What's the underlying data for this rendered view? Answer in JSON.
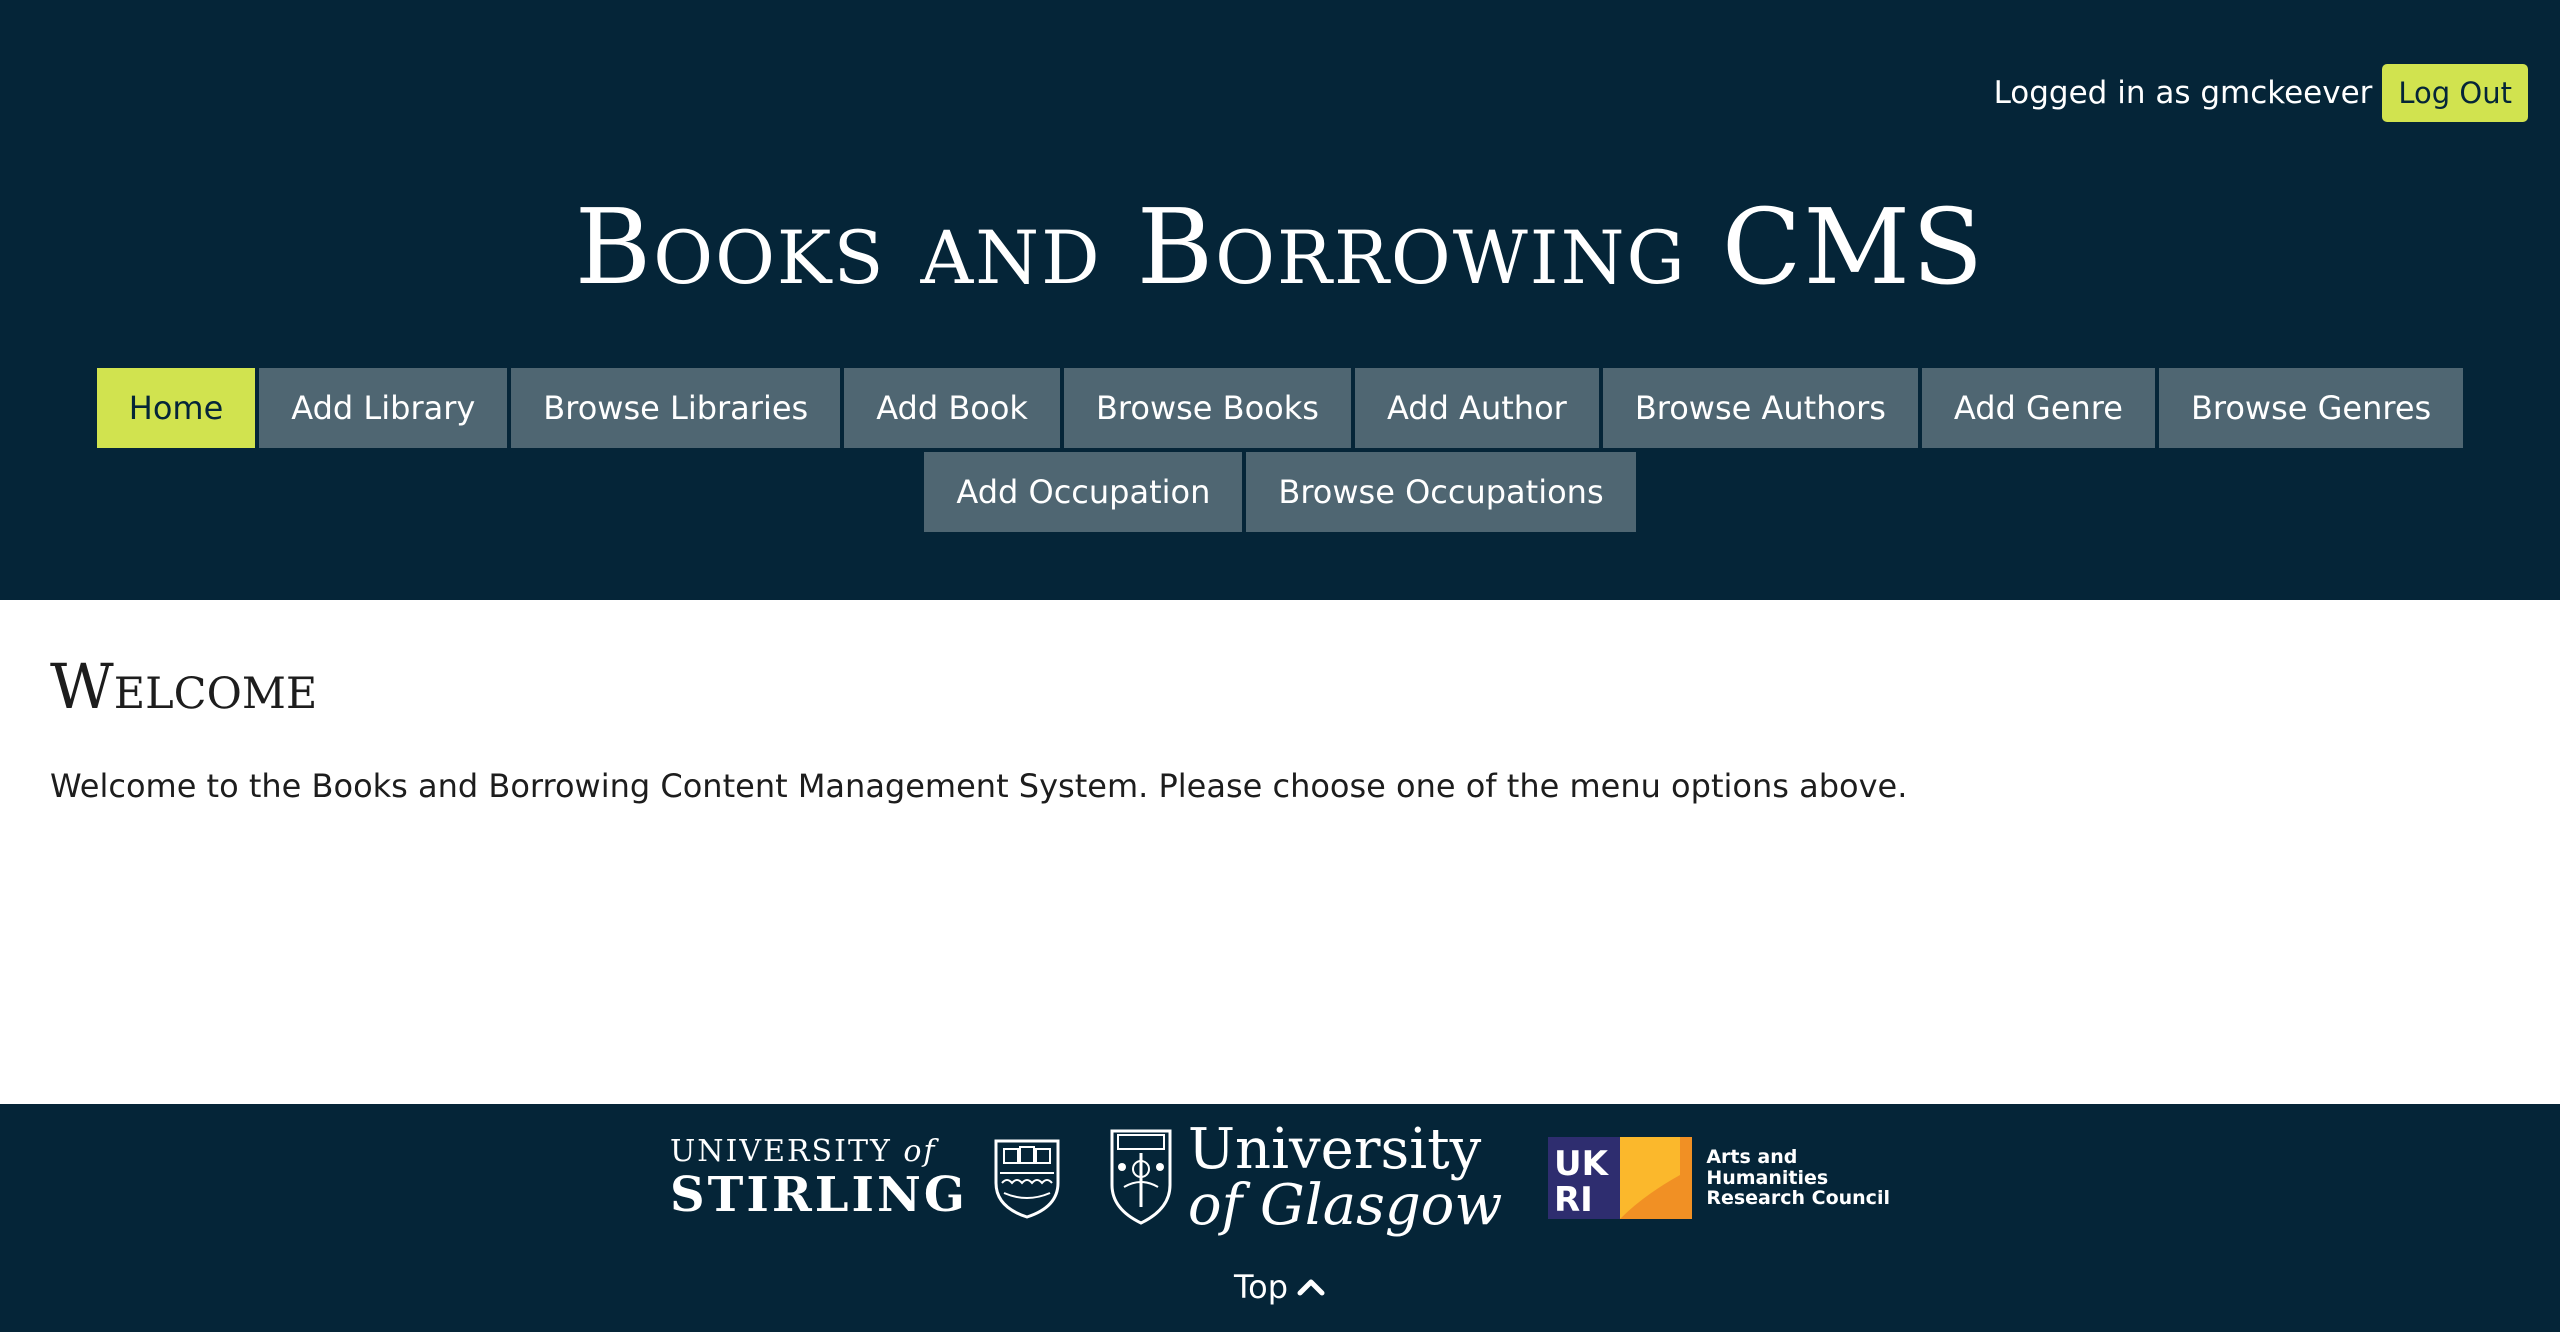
{
  "header": {
    "login_text": "Logged in as gmckeever",
    "logout_label": "Log Out",
    "site_title": "Books and Borrowing CMS"
  },
  "nav": {
    "row1": [
      "Home",
      "Add Library",
      "Browse Libraries",
      "Add Book",
      "Browse Books",
      "Add Author",
      "Browse Authors",
      "Add Genre",
      "Browse Genres"
    ],
    "row2": [
      "Add Occupation",
      "Browse Occupations"
    ],
    "active": "Home"
  },
  "main": {
    "title": "Welcome",
    "text": "Welcome to the Books and Borrowing Content Management System. Please choose one of the menu options above."
  },
  "footer": {
    "stirling_top": "UNIVERSITY",
    "stirling_of": "of",
    "stirling_main": "STIRLING",
    "glasgow_a": "University",
    "glasgow_b": "of Glasgow",
    "ukri_line1": "Arts and",
    "ukri_line2": "Humanities",
    "ukri_line3": "Research Council",
    "top_label": "Top"
  },
  "colors": {
    "header_bg": "#052538",
    "accent": "#d1e34f",
    "nav_bg": "#4f6672"
  },
  "icons": {
    "top": "chevron-up-icon"
  }
}
